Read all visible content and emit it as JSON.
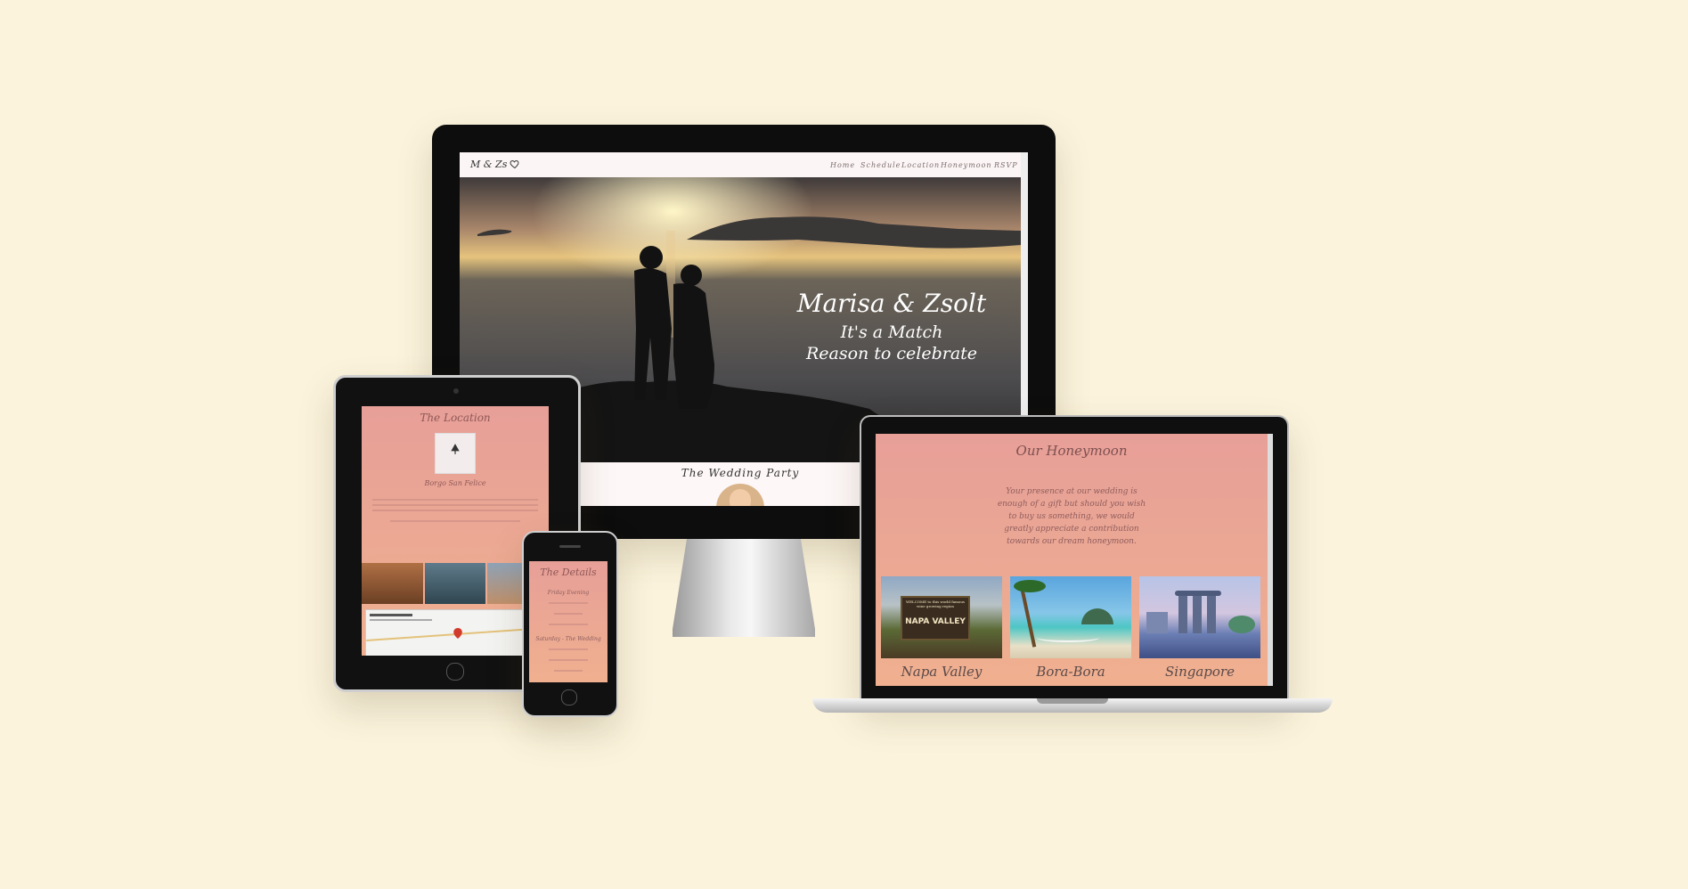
{
  "colors": {
    "background": "#fbf3dc",
    "accent": "#e99e98",
    "accent2": "#f0b18f",
    "bezel": "#111111"
  },
  "monitor": {
    "logo": "M & Zs",
    "heart_icon": "heart-icon",
    "nav": [
      "Home",
      "Schedule",
      "Location",
      "Honeymoon",
      "RSVP"
    ],
    "hero": {
      "title": "Marisa & Zsolt",
      "line1": "It's a Match",
      "line2": "Reason to celebrate"
    },
    "section_title": "The Wedding Party"
  },
  "laptop": {
    "heading": "Our Honeymoon",
    "message": "Your presence at our wedding is enough of a gift but should you wish to buy us something, we would greatly appreciate a contribution towards our dream honeymoon.",
    "cards": [
      {
        "label": "Napa Valley",
        "sign": "NAPA VALLEY",
        "sign_small": "WELCOME to this world famous wine growing region"
      },
      {
        "label": "Bora-Bora"
      },
      {
        "label": "Singapore"
      }
    ]
  },
  "tablet": {
    "heading": "The Location",
    "venue": "Borgo San Felice"
  },
  "phone": {
    "heading": "The Details",
    "items": [
      "Friday Evening",
      "Saturday - The Wedding"
    ]
  }
}
